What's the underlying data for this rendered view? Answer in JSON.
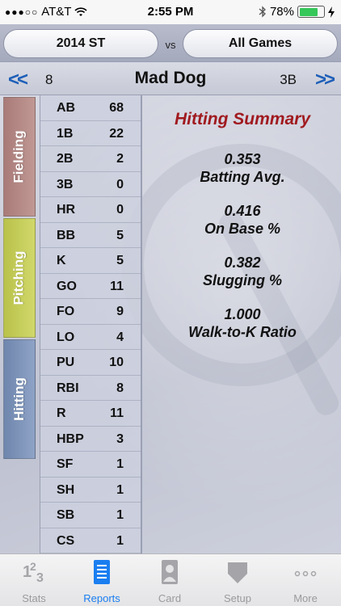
{
  "status": {
    "carrier": "AT&T",
    "time": "2:55 PM",
    "battery": "78%",
    "battery_level": 0.78
  },
  "selector": {
    "left": "2014 ST",
    "vs": "vs",
    "right": "All Games"
  },
  "player": {
    "prev": "<<",
    "number": "8",
    "name": "Mad Dog",
    "position": "3B",
    "next": ">>"
  },
  "side_tabs": [
    "Fielding",
    "Pitching",
    "Hitting"
  ],
  "stats": [
    {
      "label": "AB",
      "value": "68"
    },
    {
      "label": "1B",
      "value": "22"
    },
    {
      "label": "2B",
      "value": "2"
    },
    {
      "label": "3B",
      "value": "0"
    },
    {
      "label": "HR",
      "value": "0"
    },
    {
      "label": "BB",
      "value": "5"
    },
    {
      "label": "K",
      "value": "5"
    },
    {
      "label": "GO",
      "value": "11"
    },
    {
      "label": "FO",
      "value": "9"
    },
    {
      "label": "LO",
      "value": "4"
    },
    {
      "label": "PU",
      "value": "10"
    },
    {
      "label": "RBI",
      "value": "8"
    },
    {
      "label": "R",
      "value": "11"
    },
    {
      "label": "HBP",
      "value": "3"
    },
    {
      "label": "SF",
      "value": "1"
    },
    {
      "label": "SH",
      "value": "1"
    },
    {
      "label": "SB",
      "value": "1"
    },
    {
      "label": "CS",
      "value": "1"
    }
  ],
  "summary": {
    "title": "Hitting Summary",
    "metrics": [
      {
        "value": "0.353",
        "label": "Batting Avg."
      },
      {
        "value": "0.416",
        "label": "On Base %"
      },
      {
        "value": "0.382",
        "label": "Slugging %"
      },
      {
        "value": "1.000",
        "label": "Walk-to-K Ratio"
      }
    ]
  },
  "tabbar": {
    "items": [
      {
        "label": "Stats",
        "icon": "numbers-icon"
      },
      {
        "label": "Reports",
        "icon": "report-icon"
      },
      {
        "label": "Card",
        "icon": "card-icon"
      },
      {
        "label": "Setup",
        "icon": "home-plate-icon"
      },
      {
        "label": "More",
        "icon": "more-icon"
      }
    ],
    "active": "Reports"
  },
  "colors": {
    "accent": "#1a7ef0",
    "nav_arrow": "#1f5fb8",
    "summary_title": "#a01a1f",
    "fielding_tab": "#b38a87",
    "pitching_tab": "#c6cd5a",
    "hitting_tab": "#7e94b9"
  }
}
